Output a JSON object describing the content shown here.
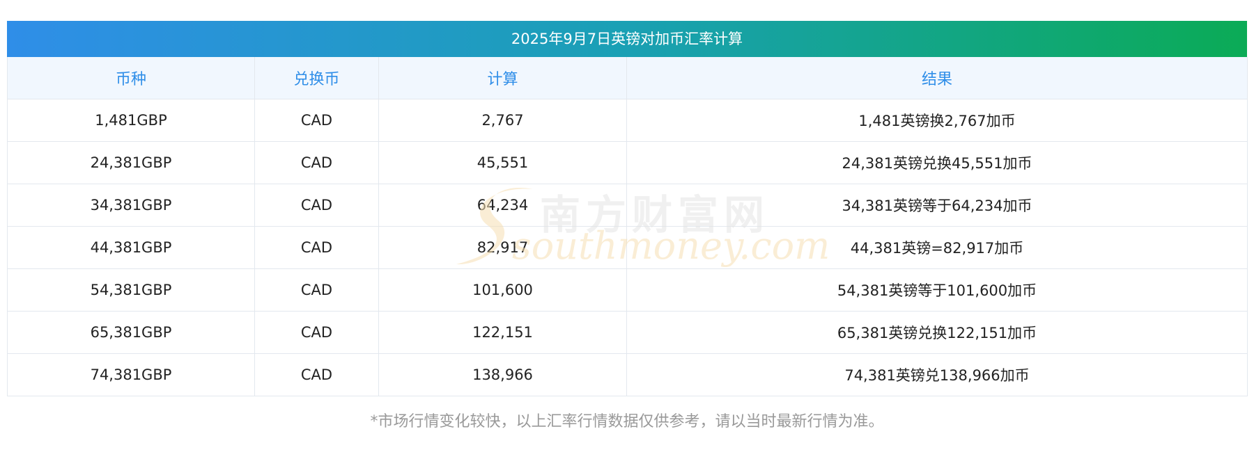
{
  "table": {
    "title": "2025年9月7日英镑对加币汇率计算",
    "headers": [
      "币种",
      "兑换币",
      "计算",
      "结果"
    ],
    "rows": [
      {
        "currency": "1,481GBP",
        "target": "CAD",
        "calc": "2,767",
        "result": "1,481英镑换2,767加币"
      },
      {
        "currency": "24,381GBP",
        "target": "CAD",
        "calc": "45,551",
        "result": "24,381英镑兑换45,551加币"
      },
      {
        "currency": "34,381GBP",
        "target": "CAD",
        "calc": "64,234",
        "result": "34,381英镑等于64,234加币"
      },
      {
        "currency": "44,381GBP",
        "target": "CAD",
        "calc": "82,917",
        "result": "44,381英镑=82,917加币"
      },
      {
        "currency": "54,381GBP",
        "target": "CAD",
        "calc": "101,600",
        "result": "54,381英镑等于101,600加币"
      },
      {
        "currency": "65,381GBP",
        "target": "CAD",
        "calc": "122,151",
        "result": "65,381英镑兑换122,151加币"
      },
      {
        "currency": "74,381GBP",
        "target": "CAD",
        "calc": "138,966",
        "result": "74,381英镑兑138,966加币"
      }
    ]
  },
  "footnote": "*市场行情变化较快，以上汇率行情数据仅供参考，请以当时最新行情为准。",
  "watermark": {
    "cn": "南方财富网",
    "en": "southmoney.com"
  },
  "colors": {
    "title_gradient_start": "#2f8ee8",
    "title_gradient_end": "#0bab56",
    "header_text": "#2f8ee8",
    "header_bg": "#f1f7fe",
    "footnote_text": "#999999"
  }
}
